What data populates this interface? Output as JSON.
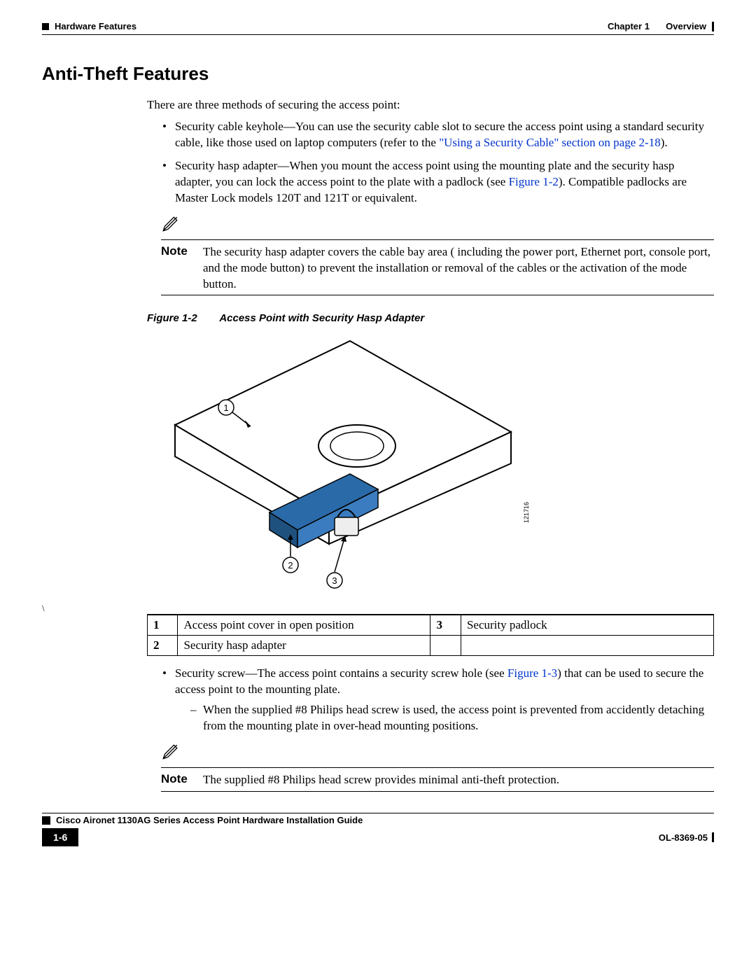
{
  "header": {
    "section_left": "Hardware Features",
    "chapter_label": "Chapter 1",
    "chapter_title": "Overview"
  },
  "section_heading": "Anti-Theft Features",
  "intro": "There are three methods of securing the access point:",
  "bullet1": {
    "lead": "Security cable keyhole—You can use the security cable slot to secure the access point using a standard security cable, like those used on laptop computers (refer to the ",
    "link_text": "\"Using a Security Cable\" section on page 2-18",
    "tail": ")."
  },
  "bullet2": {
    "lead": "Security hasp adapter—When you mount the access point using the mounting plate and the security hasp adapter, you can lock the access point to the plate with a padlock (see ",
    "link_text": "Figure 1-2",
    "tail": "). Compatible padlocks are Master Lock models 120T and 121T or equivalent."
  },
  "note1": {
    "label": "Note",
    "body": "The security hasp adapter covers the cable bay area ( including the power port, Ethernet port, console port, and the mode button) to prevent the installation or removal of the cables or the activation of the mode button."
  },
  "figure": {
    "num": "Figure 1-2",
    "title": "Access Point with Security Hasp Adapter",
    "callouts": {
      "c1": "1",
      "c2": "2",
      "c3": "3"
    },
    "image_id": "121716"
  },
  "stray_char": "\\",
  "legend": {
    "r1n": "1",
    "r1t": "Access point cover in open position",
    "r2n": "3",
    "r2t": "Security padlock",
    "r3n": "2",
    "r3t": "Security hasp adapter"
  },
  "bullet3": {
    "lead": "Security screw—The access point contains a security screw hole (see ",
    "link_text": "Figure 1-3",
    "tail": ") that can be used to secure the access point to the mounting plate."
  },
  "dash1": "When the supplied #8 Philips head screw is used, the access point is prevented from accidently detaching from the mounting plate in over-head mounting positions.",
  "note2": {
    "label": "Note",
    "body": "The supplied #8 Philips head screw provides minimal anti-theft protection."
  },
  "footer": {
    "doc_title": "Cisco Aironet 1130AG Series Access Point Hardware Installation Guide",
    "page_num": "1-6",
    "doc_id": "OL-8369-05"
  }
}
